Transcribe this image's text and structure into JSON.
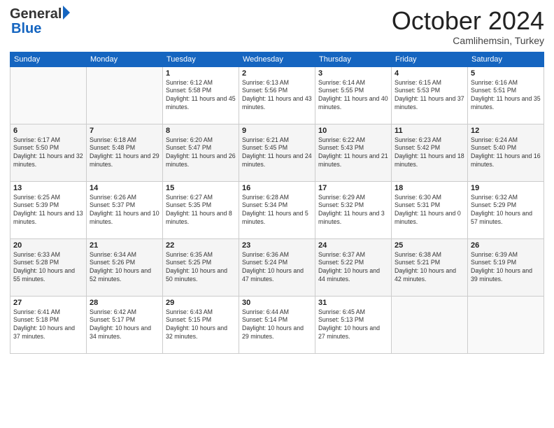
{
  "logo": {
    "general": "General",
    "blue": "Blue"
  },
  "title": "October 2024",
  "subtitle": "Camlihemsin, Turkey",
  "days_of_week": [
    "Sunday",
    "Monday",
    "Tuesday",
    "Wednesday",
    "Thursday",
    "Friday",
    "Saturday"
  ],
  "weeks": [
    [
      {
        "day": "",
        "sunrise": "",
        "sunset": "",
        "daylight": ""
      },
      {
        "day": "",
        "sunrise": "",
        "sunset": "",
        "daylight": ""
      },
      {
        "day": "1",
        "sunrise": "Sunrise: 6:12 AM",
        "sunset": "Sunset: 5:58 PM",
        "daylight": "Daylight: 11 hours and 45 minutes."
      },
      {
        "day": "2",
        "sunrise": "Sunrise: 6:13 AM",
        "sunset": "Sunset: 5:56 PM",
        "daylight": "Daylight: 11 hours and 43 minutes."
      },
      {
        "day": "3",
        "sunrise": "Sunrise: 6:14 AM",
        "sunset": "Sunset: 5:55 PM",
        "daylight": "Daylight: 11 hours and 40 minutes."
      },
      {
        "day": "4",
        "sunrise": "Sunrise: 6:15 AM",
        "sunset": "Sunset: 5:53 PM",
        "daylight": "Daylight: 11 hours and 37 minutes."
      },
      {
        "day": "5",
        "sunrise": "Sunrise: 6:16 AM",
        "sunset": "Sunset: 5:51 PM",
        "daylight": "Daylight: 11 hours and 35 minutes."
      }
    ],
    [
      {
        "day": "6",
        "sunrise": "Sunrise: 6:17 AM",
        "sunset": "Sunset: 5:50 PM",
        "daylight": "Daylight: 11 hours and 32 minutes."
      },
      {
        "day": "7",
        "sunrise": "Sunrise: 6:18 AM",
        "sunset": "Sunset: 5:48 PM",
        "daylight": "Daylight: 11 hours and 29 minutes."
      },
      {
        "day": "8",
        "sunrise": "Sunrise: 6:20 AM",
        "sunset": "Sunset: 5:47 PM",
        "daylight": "Daylight: 11 hours and 26 minutes."
      },
      {
        "day": "9",
        "sunrise": "Sunrise: 6:21 AM",
        "sunset": "Sunset: 5:45 PM",
        "daylight": "Daylight: 11 hours and 24 minutes."
      },
      {
        "day": "10",
        "sunrise": "Sunrise: 6:22 AM",
        "sunset": "Sunset: 5:43 PM",
        "daylight": "Daylight: 11 hours and 21 minutes."
      },
      {
        "day": "11",
        "sunrise": "Sunrise: 6:23 AM",
        "sunset": "Sunset: 5:42 PM",
        "daylight": "Daylight: 11 hours and 18 minutes."
      },
      {
        "day": "12",
        "sunrise": "Sunrise: 6:24 AM",
        "sunset": "Sunset: 5:40 PM",
        "daylight": "Daylight: 11 hours and 16 minutes."
      }
    ],
    [
      {
        "day": "13",
        "sunrise": "Sunrise: 6:25 AM",
        "sunset": "Sunset: 5:39 PM",
        "daylight": "Daylight: 11 hours and 13 minutes."
      },
      {
        "day": "14",
        "sunrise": "Sunrise: 6:26 AM",
        "sunset": "Sunset: 5:37 PM",
        "daylight": "Daylight: 11 hours and 10 minutes."
      },
      {
        "day": "15",
        "sunrise": "Sunrise: 6:27 AM",
        "sunset": "Sunset: 5:35 PM",
        "daylight": "Daylight: 11 hours and 8 minutes."
      },
      {
        "day": "16",
        "sunrise": "Sunrise: 6:28 AM",
        "sunset": "Sunset: 5:34 PM",
        "daylight": "Daylight: 11 hours and 5 minutes."
      },
      {
        "day": "17",
        "sunrise": "Sunrise: 6:29 AM",
        "sunset": "Sunset: 5:32 PM",
        "daylight": "Daylight: 11 hours and 3 minutes."
      },
      {
        "day": "18",
        "sunrise": "Sunrise: 6:30 AM",
        "sunset": "Sunset: 5:31 PM",
        "daylight": "Daylight: 11 hours and 0 minutes."
      },
      {
        "day": "19",
        "sunrise": "Sunrise: 6:32 AM",
        "sunset": "Sunset: 5:29 PM",
        "daylight": "Daylight: 10 hours and 57 minutes."
      }
    ],
    [
      {
        "day": "20",
        "sunrise": "Sunrise: 6:33 AM",
        "sunset": "Sunset: 5:28 PM",
        "daylight": "Daylight: 10 hours and 55 minutes."
      },
      {
        "day": "21",
        "sunrise": "Sunrise: 6:34 AM",
        "sunset": "Sunset: 5:26 PM",
        "daylight": "Daylight: 10 hours and 52 minutes."
      },
      {
        "day": "22",
        "sunrise": "Sunrise: 6:35 AM",
        "sunset": "Sunset: 5:25 PM",
        "daylight": "Daylight: 10 hours and 50 minutes."
      },
      {
        "day": "23",
        "sunrise": "Sunrise: 6:36 AM",
        "sunset": "Sunset: 5:24 PM",
        "daylight": "Daylight: 10 hours and 47 minutes."
      },
      {
        "day": "24",
        "sunrise": "Sunrise: 6:37 AM",
        "sunset": "Sunset: 5:22 PM",
        "daylight": "Daylight: 10 hours and 44 minutes."
      },
      {
        "day": "25",
        "sunrise": "Sunrise: 6:38 AM",
        "sunset": "Sunset: 5:21 PM",
        "daylight": "Daylight: 10 hours and 42 minutes."
      },
      {
        "day": "26",
        "sunrise": "Sunrise: 6:39 AM",
        "sunset": "Sunset: 5:19 PM",
        "daylight": "Daylight: 10 hours and 39 minutes."
      }
    ],
    [
      {
        "day": "27",
        "sunrise": "Sunrise: 6:41 AM",
        "sunset": "Sunset: 5:18 PM",
        "daylight": "Daylight: 10 hours and 37 minutes."
      },
      {
        "day": "28",
        "sunrise": "Sunrise: 6:42 AM",
        "sunset": "Sunset: 5:17 PM",
        "daylight": "Daylight: 10 hours and 34 minutes."
      },
      {
        "day": "29",
        "sunrise": "Sunrise: 6:43 AM",
        "sunset": "Sunset: 5:15 PM",
        "daylight": "Daylight: 10 hours and 32 minutes."
      },
      {
        "day": "30",
        "sunrise": "Sunrise: 6:44 AM",
        "sunset": "Sunset: 5:14 PM",
        "daylight": "Daylight: 10 hours and 29 minutes."
      },
      {
        "day": "31",
        "sunrise": "Sunrise: 6:45 AM",
        "sunset": "Sunset: 5:13 PM",
        "daylight": "Daylight: 10 hours and 27 minutes."
      },
      {
        "day": "",
        "sunrise": "",
        "sunset": "",
        "daylight": ""
      },
      {
        "day": "",
        "sunrise": "",
        "sunset": "",
        "daylight": ""
      }
    ]
  ]
}
